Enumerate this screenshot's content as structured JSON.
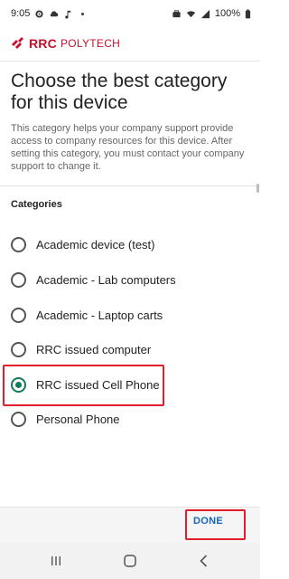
{
  "status_bar": {
    "time": "9:05",
    "battery": "100%"
  },
  "brand": {
    "name_bold": "RRC",
    "name_light": "POLYTECH",
    "accent": "#c8102e"
  },
  "page": {
    "title": "Choose the best category for this device",
    "description": "This category helps your company support provide access to company resources for this device. After setting this category, you must contact your company support to change it."
  },
  "categories": {
    "label": "Categories",
    "options": [
      {
        "label": "Academic device (test)",
        "selected": false
      },
      {
        "label": "Academic - Lab computers",
        "selected": false
      },
      {
        "label": "Academic - Laptop carts",
        "selected": false
      },
      {
        "label": "RRC issued computer",
        "selected": false
      },
      {
        "label": "RRC issued Cell Phone",
        "selected": true
      },
      {
        "label": "Personal Phone",
        "selected": false
      }
    ]
  },
  "footer": {
    "done_label": "DONE",
    "done_color": "#1565c0"
  },
  "nav": {
    "icons": [
      "recent-apps-icon",
      "home-icon",
      "back-icon"
    ]
  }
}
